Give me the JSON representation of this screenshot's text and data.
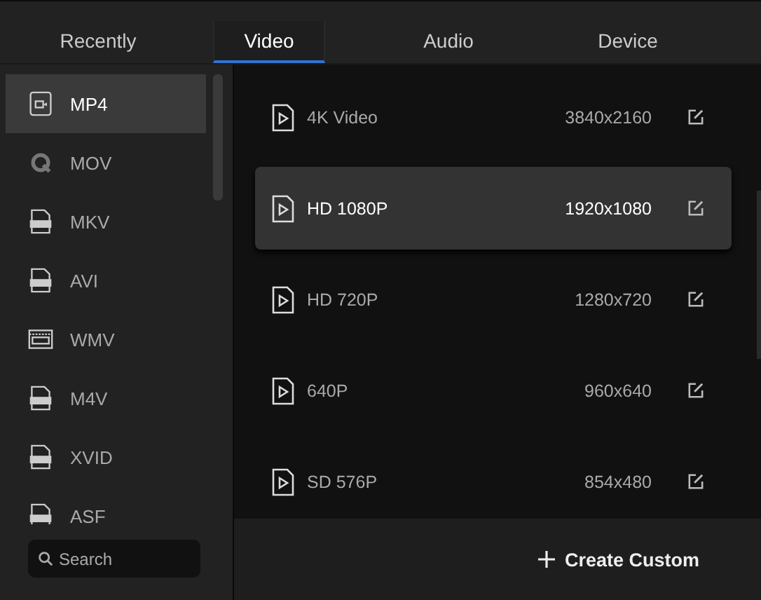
{
  "tabs": [
    {
      "label": "Recently",
      "selected": false
    },
    {
      "label": "Video",
      "selected": true
    },
    {
      "label": "Audio",
      "selected": false
    },
    {
      "label": "Device",
      "selected": false
    }
  ],
  "formats": [
    {
      "label": "MP4",
      "kind": "camera",
      "selected": true
    },
    {
      "label": "MOV",
      "kind": "quicktime",
      "selected": false
    },
    {
      "label": "MKV",
      "kind": "badge",
      "selected": false
    },
    {
      "label": "AVI",
      "kind": "badge",
      "selected": false
    },
    {
      "label": "WMV",
      "kind": "film",
      "selected": false
    },
    {
      "label": "M4V",
      "kind": "badge",
      "selected": false
    },
    {
      "label": "XVID",
      "kind": "badge",
      "selected": false
    },
    {
      "label": "ASF",
      "kind": "badge",
      "selected": false
    }
  ],
  "search": {
    "placeholder": "Search"
  },
  "presets": [
    {
      "name": "4K Video",
      "resolution": "3840x2160",
      "selected": false
    },
    {
      "name": "HD 1080P",
      "resolution": "1920x1080",
      "selected": true
    },
    {
      "name": "HD 720P",
      "resolution": "1280x720",
      "selected": false
    },
    {
      "name": "640P",
      "resolution": "960x640",
      "selected": false
    },
    {
      "name": "SD 576P",
      "resolution": "854x480",
      "selected": false
    }
  ],
  "create_button": {
    "label": "Create Custom"
  }
}
